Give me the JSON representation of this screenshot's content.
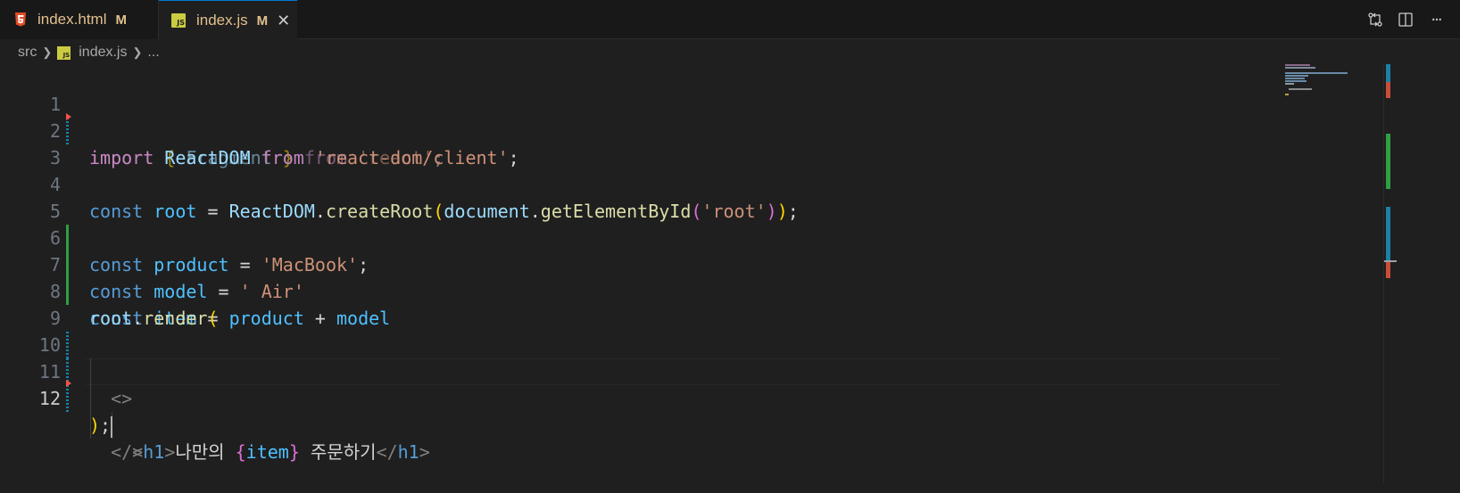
{
  "tabs": [
    {
      "name": "index.html",
      "modified": "M",
      "icon": "html5-icon"
    },
    {
      "name": "index.js",
      "modified": "M",
      "icon": "js-file-icon",
      "active": true
    }
  ],
  "tab_close_glyph": "✕",
  "toolbar": {
    "actions": [
      "compare-changes-icon",
      "split-editor-icon",
      "more-actions-icon"
    ],
    "more_glyph": "···"
  },
  "breadcrumb": {
    "folder": "src",
    "file": "index.js",
    "ellipsis": "...",
    "js_badge": "JS"
  },
  "code": {
    "line_numbers": [
      "1",
      "2",
      "3",
      "4",
      "5",
      "6",
      "7",
      "8",
      "9",
      "10",
      "11",
      "12"
    ],
    "active_line": "12"
  },
  "colors": {
    "keyword": "#c586c0",
    "declaration": "#569cd6",
    "variable": "#9cdcfe",
    "constant": "#4fc1ff",
    "string": "#ce9178",
    "function": "#dcdcaa",
    "bracket_gold": "#ffd700",
    "bracket_purple": "#da70d6",
    "bracket_blue": "#179fff",
    "modified_tab": "#e2c08d",
    "git_added": "#2ea043",
    "git_modified": "#1b81a8",
    "git_deleted": "#f85149"
  }
}
